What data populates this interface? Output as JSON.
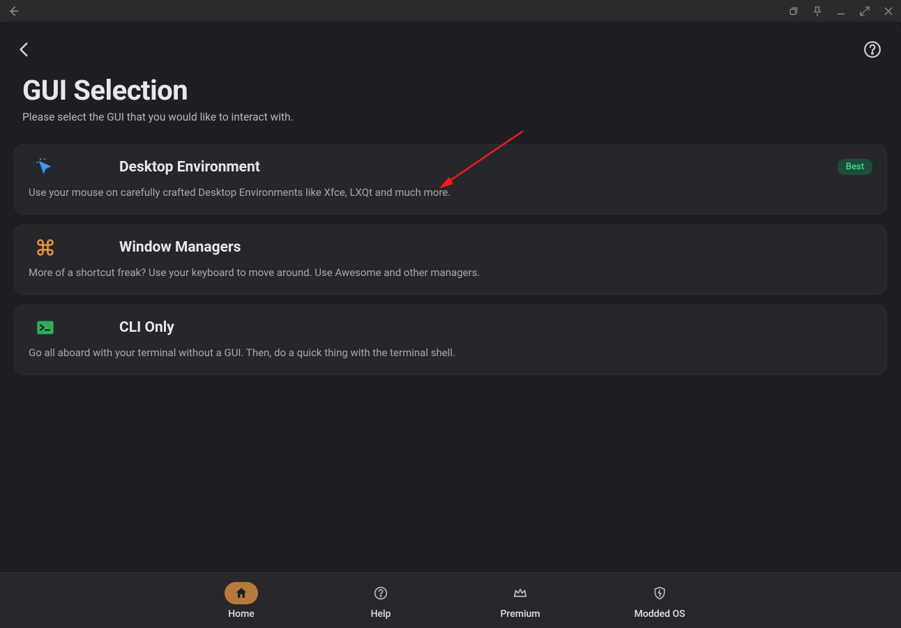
{
  "header": {
    "title": "GUI Selection",
    "subtitle": "Please select the GUI that you would like to interact with."
  },
  "options": [
    {
      "title": "Desktop Environment",
      "description": "Use your mouse on carefully crafted Desktop Environments like Xfce, LXQt and much more.",
      "badge": "Best"
    },
    {
      "title": "Window Managers",
      "description": "More of a shortcut freak? Use your keyboard to move around. Use Awesome and other managers."
    },
    {
      "title": "CLI Only",
      "description": "Go all aboard with your terminal without a GUI. Then, do a quick thing with the terminal shell."
    }
  ],
  "nav": [
    {
      "label": "Home"
    },
    {
      "label": "Help"
    },
    {
      "label": "Premium"
    },
    {
      "label": "Modded OS"
    }
  ]
}
